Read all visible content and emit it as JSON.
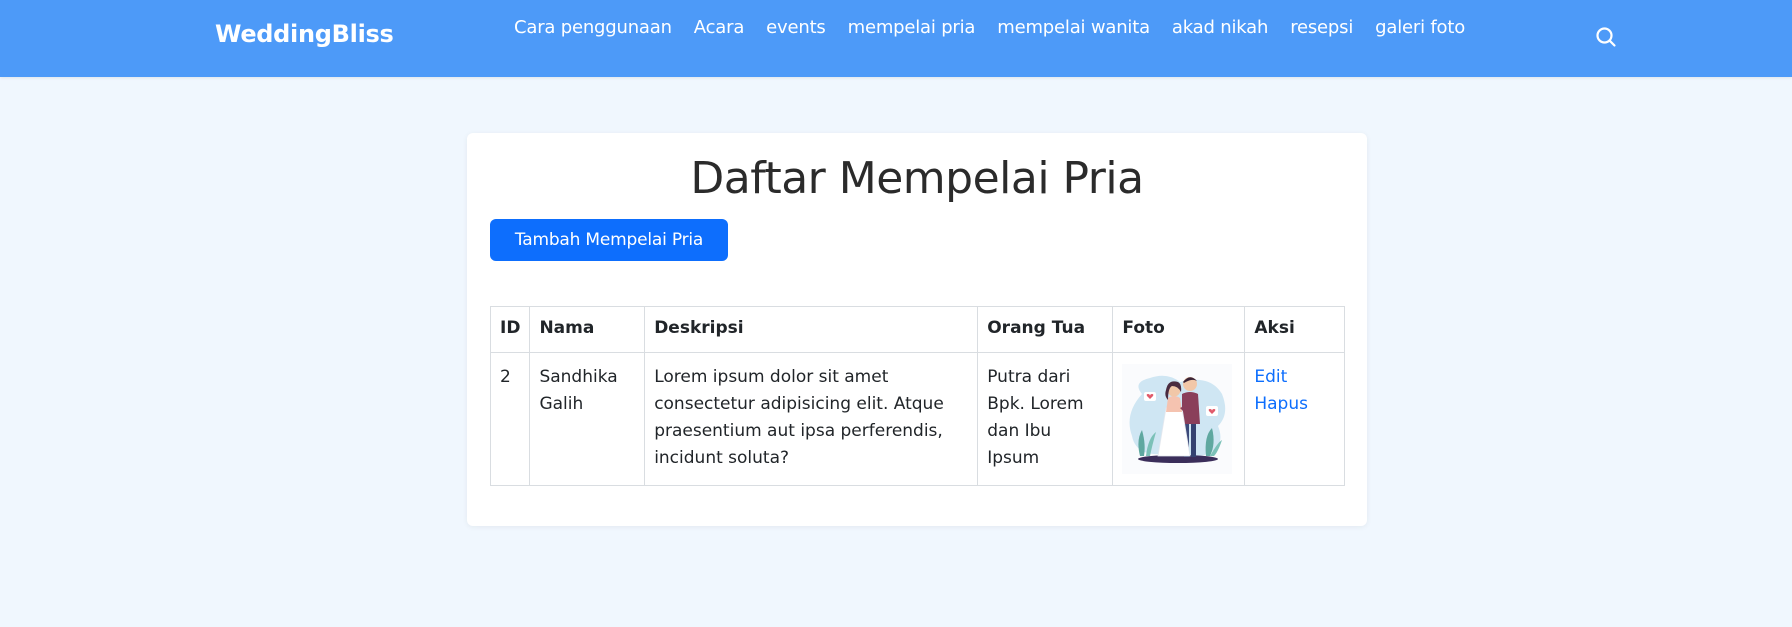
{
  "navbar": {
    "brand": "WeddingBliss",
    "links": [
      "Cara penggunaan",
      "Acara",
      "events",
      "mempelai pria",
      "mempelai wanita",
      "akad nikah",
      "resepsi",
      "galeri foto"
    ],
    "search_icon": "search-icon"
  },
  "main": {
    "title": "Daftar Mempelai Pria",
    "add_button": "Tambah Mempelai Pria",
    "table": {
      "headers": [
        "ID",
        "Nama",
        "Deskripsi",
        "Orang Tua",
        "Foto",
        "Aksi"
      ],
      "rows": [
        {
          "id": "2",
          "nama": "Sandhika Galih",
          "deskripsi": "Lorem ipsum dolor sit amet consectetur adipisicing elit. Atque praesentium aut ipsa perferendis, incidunt soluta?",
          "orang_tua": "Putra dari Bpk. Lorem dan Ibu Ipsum",
          "foto": "couple-illustration",
          "edit_label": "Edit",
          "delete_label": "Hapus"
        }
      ]
    }
  },
  "colors": {
    "navbar": "#4d9af8",
    "page_background": "#f0f7fe",
    "primary_button": "#0d6efd",
    "link": "#0d6efd"
  }
}
